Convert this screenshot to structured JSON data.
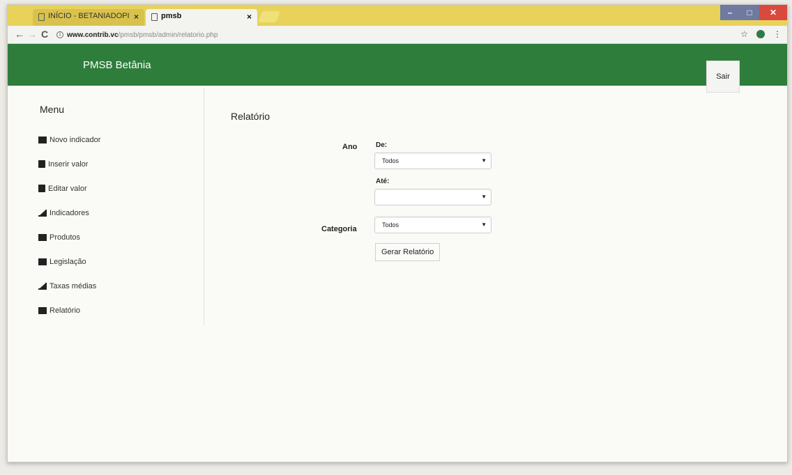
{
  "browser": {
    "tabs": [
      {
        "label": "INÍCIO - BETANIADOPI"
      },
      {
        "label": "pmsb"
      }
    ],
    "url": {
      "domain": "www.contrib.vc",
      "path": "/pmsb/pmsb/admin/relatorio.php"
    }
  },
  "header": {
    "brand": "PMSB Betânia",
    "logout_label": "Sair"
  },
  "sidebar": {
    "title": "Menu",
    "items": [
      {
        "label": "Novo indicador",
        "icon": "list-icon"
      },
      {
        "label": "Inserir valor",
        "icon": "document-icon"
      },
      {
        "label": "Editar valor",
        "icon": "document-edit-icon"
      },
      {
        "label": "Indicadores",
        "icon": "chart-icon"
      },
      {
        "label": "Produtos",
        "icon": "book-icon"
      },
      {
        "label": "Legislação",
        "icon": "list-icon"
      },
      {
        "label": "Taxas médias",
        "icon": "chart-icon"
      },
      {
        "label": "Relatório",
        "icon": "book-icon"
      }
    ]
  },
  "main": {
    "title": "Relatório",
    "form": {
      "ano_label": "Ano",
      "de_label": "De:",
      "de_value": "Todos",
      "ate_label": "Até:",
      "ate_value": "",
      "categoria_label": "Categoria",
      "categoria_value": "Todos",
      "submit_label": "Gerar Relatório"
    }
  },
  "colors": {
    "header": "#2e7d3b",
    "tabstrip": "#e8d25a"
  }
}
